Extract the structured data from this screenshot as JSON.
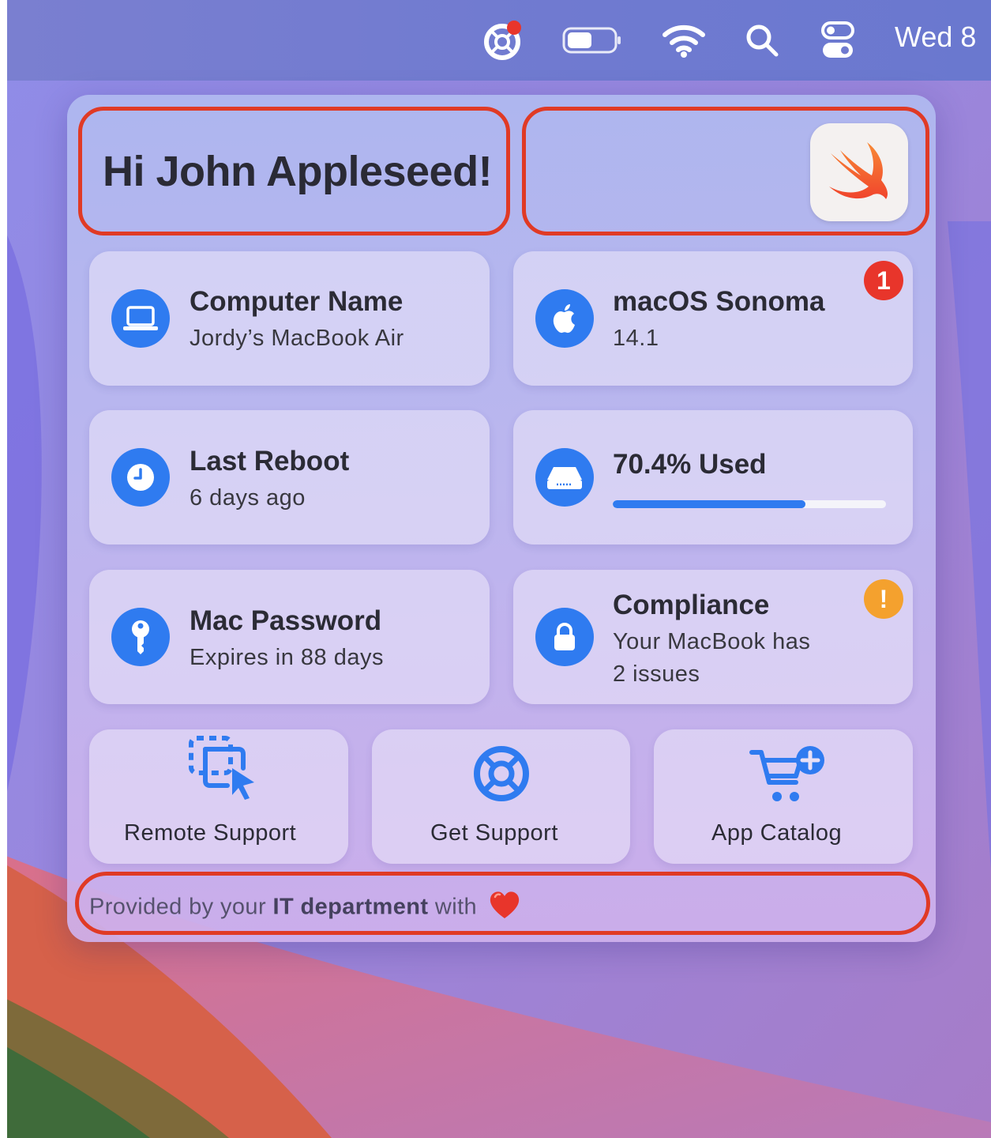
{
  "menubar": {
    "icons": [
      "lifebuoy-icon",
      "battery-icon",
      "wifi-icon",
      "spotlight-search-icon",
      "control-center-icon"
    ],
    "clock": "Wed 8"
  },
  "header": {
    "greeting": "Hi John Appleseed!",
    "logo": "swift-logo"
  },
  "cards": {
    "computer_name": {
      "title": "Computer Name",
      "value": "Jordy’s MacBook Air",
      "icon": "laptop-icon"
    },
    "macos": {
      "title": "macOS Sonoma",
      "value": "14.1",
      "icon": "apple-logo-icon",
      "badge": "1",
      "badge_color": "#e8352b"
    },
    "last_reboot": {
      "title": "Last Reboot",
      "value": "6 days ago",
      "icon": "clock-icon"
    },
    "storage": {
      "title": "70.4% Used",
      "used_fraction": 0.704,
      "icon": "drive-icon"
    },
    "password": {
      "title": "Mac Password",
      "value": "Expires in 88 days",
      "icon": "key-icon"
    },
    "compliance": {
      "title": "Compliance",
      "line1": "Your MacBook has",
      "line2": "2 issues",
      "icon": "lock-icon",
      "badge": "!",
      "badge_color": "#f4a12e"
    }
  },
  "actions": [
    {
      "label": "Remote Support",
      "icon": "remote-screen-icon"
    },
    {
      "label": "Get Support",
      "icon": "lifebuoy-icon"
    },
    {
      "label": "App Catalog",
      "icon": "cart-add-icon"
    }
  ],
  "footer": {
    "prefix": "Provided by your",
    "emphasis": "IT department",
    "suffix": "with",
    "emoji": "❤️"
  },
  "colors": {
    "accent": "#2f7bf0",
    "highlight_outline": "#e03a25"
  }
}
